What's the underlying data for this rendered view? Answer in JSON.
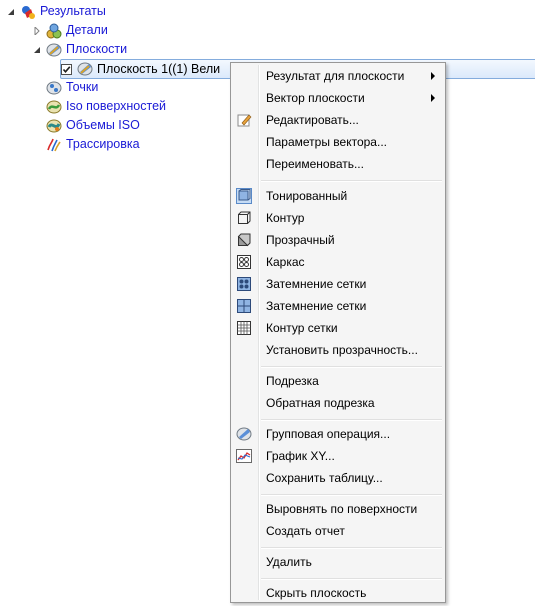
{
  "tree": {
    "root": {
      "label": "Результаты",
      "icon": "results-icon"
    },
    "items": [
      {
        "label": "Детали",
        "icon": "parts-icon"
      },
      {
        "label": "Плоскости",
        "icon": "plane-icon"
      },
      {
        "label": "Плоскость 1((1) Вели",
        "icon": "plane-icon",
        "checked": true
      },
      {
        "label": "Точки",
        "icon": "points-icon"
      },
      {
        "label": "Iso поверхностей",
        "icon": "iso-surface-icon"
      },
      {
        "label": "Объемы ISO",
        "icon": "iso-volume-icon"
      },
      {
        "label": "Трассировка",
        "icon": "trace-icon"
      }
    ]
  },
  "menu": {
    "items": [
      {
        "label": "Результат для плоскости",
        "submenu": true
      },
      {
        "label": "Вектор плоскости",
        "submenu": true
      },
      {
        "label": "Редактировать...",
        "icon": "edit-icon"
      },
      {
        "label": "Параметры вектора..."
      },
      {
        "label": "Переименовать..."
      },
      {
        "label": "Тонированный",
        "icon": "shaded-icon"
      },
      {
        "label": "Контур",
        "icon": "outline-icon"
      },
      {
        "label": "Прозрачный",
        "icon": "transparent-icon"
      },
      {
        "label": "Каркас",
        "icon": "wireframe-icon"
      },
      {
        "label": "Затемнение сетки",
        "icon": "mesh-shade-icon"
      },
      {
        "label": "Затемнение сетки",
        "icon": "mesh-shade-2-icon"
      },
      {
        "label": "Контур сетки",
        "icon": "mesh-outline-icon"
      },
      {
        "label": "Установить прозрачность..."
      },
      {
        "label": "Подрезка"
      },
      {
        "label": "Обратная подрезка"
      },
      {
        "label": "Групповая операция...",
        "icon": "group-op-icon"
      },
      {
        "label": "График XY...",
        "icon": "xy-chart-icon"
      },
      {
        "label": "Сохранить таблицу..."
      },
      {
        "label": "Выровнять по поверхности"
      },
      {
        "label": "Создать отчет"
      },
      {
        "label": "Удалить"
      },
      {
        "label": "Скрыть плоскость"
      }
    ]
  }
}
